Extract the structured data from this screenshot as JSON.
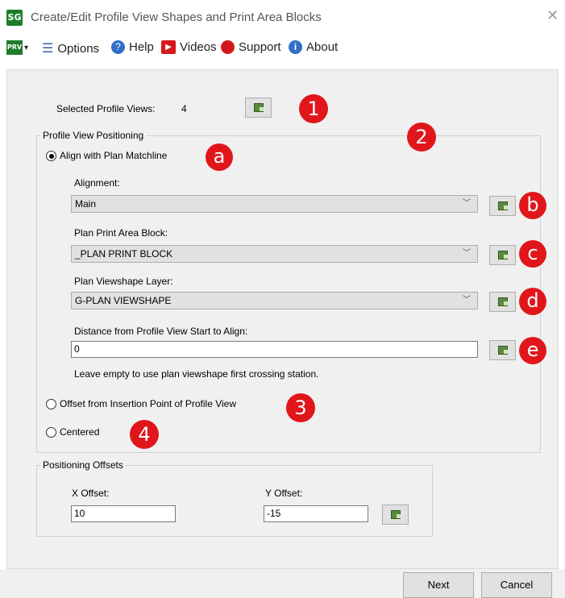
{
  "window": {
    "title": "Create/Edit Profile View Shapes and Print Area Blocks",
    "app_icon": "SG",
    "close": "✕"
  },
  "menu": {
    "prv": "PRV",
    "options": "Options",
    "help": "Help",
    "videos": "Videos",
    "support": "Support",
    "about": "About"
  },
  "selected": {
    "label": "Selected Profile Views:",
    "count": "4"
  },
  "positioning": {
    "group_title": "Profile View Positioning",
    "align_label": "Align with Plan Matchline",
    "alignment_label": "Alignment:",
    "alignment_value": "Main",
    "block_label": "Plan Print Area Block:",
    "block_value": "_PLAN PRINT BLOCK",
    "layer_label": "Plan Viewshape Layer:",
    "layer_value": "G-PLAN VIEWSHAPE",
    "distance_label": "Distance from Profile View Start to Align:",
    "distance_value": "0",
    "hint": "Leave empty to use plan viewshape first crossing station.",
    "offset_label": "Offset from Insertion Point of Profile View",
    "centered_label": "Centered"
  },
  "offsets": {
    "group_title": "Positioning Offsets",
    "x_label": "X Offset:",
    "x_value": "10",
    "y_label": "Y Offset:",
    "y_value": "-15"
  },
  "badges": {
    "n1": "1",
    "n2": "2",
    "n3": "3",
    "n4": "4",
    "a": "a",
    "b": "b",
    "c": "c",
    "d": "d",
    "e": "e"
  },
  "buttons": {
    "next": "Next",
    "cancel": "Cancel"
  },
  "colors": {
    "badge": "#e0161b",
    "panel": "#f0f0f0",
    "combo": "#e1e1e1"
  }
}
